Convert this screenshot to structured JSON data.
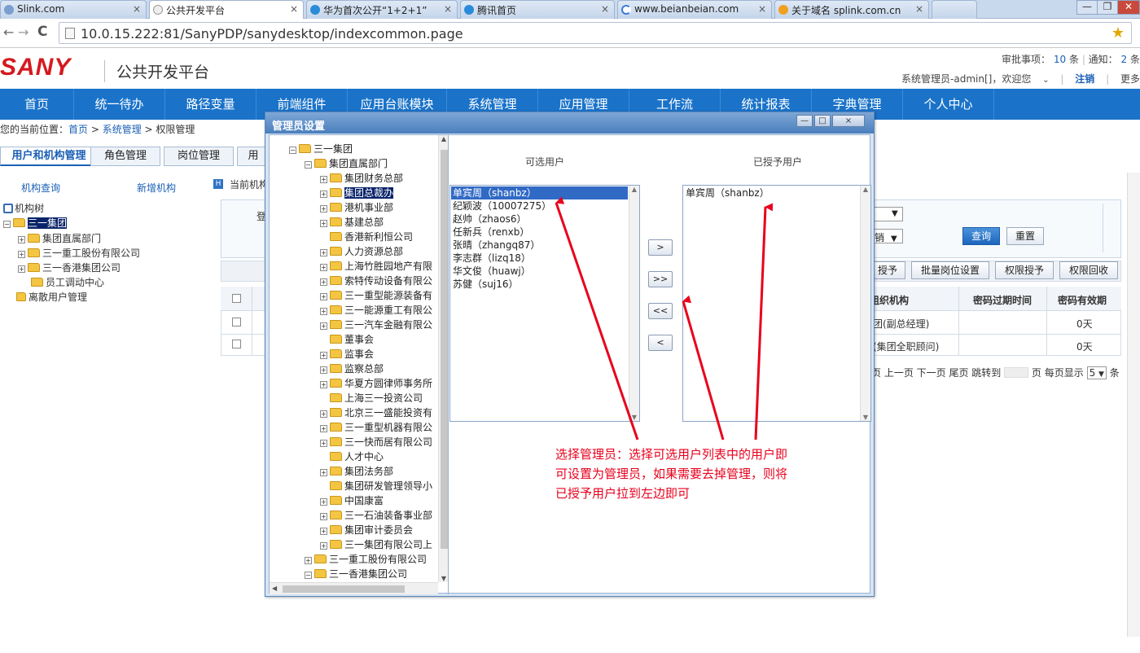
{
  "browser": {
    "tabs": [
      {
        "label": "Slink.com"
      },
      {
        "label": "公共开发平台"
      },
      {
        "label": "华为首次公开“1+2+1”"
      },
      {
        "label": "腾讯首页"
      },
      {
        "label": "www.beianbeian.com"
      },
      {
        "label": "关于域名 splink.com.cn"
      }
    ],
    "tab_close": "×",
    "url": "10.0.15.222:81/SanyPDP/sanydesktop/indexcommon.page",
    "back_glyph": "←",
    "forward_glyph": "→",
    "reload_glyph": "C",
    "star_glyph": "★",
    "menu_glyph": "≡",
    "win_min": "—",
    "win_max": "❐",
    "win_close": "✕"
  },
  "header": {
    "logo": "SANY",
    "platform": "公共开发平台",
    "approval_label": "审批事项：",
    "approval_count": "10",
    "approval_unit": "条",
    "notice_label": "通知：",
    "notice_count": "2",
    "notice_unit": "条",
    "welcome": "系统管理员-admin[]，欢迎您",
    "logout": "注销",
    "more": "更多"
  },
  "nav": [
    "首页",
    "统一待办",
    "路径变量",
    "前端组件",
    "应用台账模块",
    "系统管理",
    "应用管理",
    "工作流",
    "统计报表",
    "字典管理",
    "个人中心"
  ],
  "breadcrumb": {
    "prefix": "您的当前位置：",
    "home": "首页",
    "sep1": " > ",
    "system": "系统管理",
    "sep2": " > ",
    "current": "权限管理"
  },
  "page_tabs": [
    "用户和机构管理",
    "角色管理",
    "岗位管理",
    "用"
  ],
  "left_panel": {
    "query_org": "机构查询",
    "add_org": "新增机构",
    "tree_root": "机构树",
    "tree": [
      "三一集团",
      "集团直属部门",
      "三一重工股份有限公司",
      "三一香港集团公司",
      "员工调动中心",
      "离散用户管理"
    ]
  },
  "right_panel": {
    "current_org": "当前机构",
    "login_fragment": "登",
    "query_btn": "查询",
    "reset_btn": "重置",
    "select_glyph": "▼",
    "select2_fragment": "销",
    "actions": [
      "授予",
      "批量岗位设置",
      "权限授予",
      "权限回收"
    ],
    "table_headers": [
      "组织机构",
      "密码过期时间",
      "密码有效期"
    ],
    "rows": [
      {
        "org": "团(副总经理)",
        "expire": "",
        "validity": "0天"
      },
      {
        "org": "(集团全职顾问)",
        "expire": "",
        "validity": "0天"
      }
    ],
    "pager": "页 上一页 下一页 尾页 跳转到",
    "pager_mid": "页 每页显示",
    "page_size": "5",
    "pager_tail": "条"
  },
  "dialog": {
    "title": "管理员设置",
    "tree": [
      {
        "label": "三一集团",
        "level": 0,
        "exp": "−"
      },
      {
        "label": "集团直属部门",
        "level": 1,
        "exp": "−"
      },
      {
        "label": "集团财务总部",
        "level": 2,
        "exp": "+"
      },
      {
        "label": "集团总裁办",
        "level": 2,
        "exp": "+",
        "selected": true
      },
      {
        "label": "港机事业部",
        "level": 2,
        "exp": "+"
      },
      {
        "label": "基建总部",
        "level": 2,
        "exp": "+"
      },
      {
        "label": "香港新利恒公司",
        "level": 2,
        "exp": ""
      },
      {
        "label": "人力资源总部",
        "level": 2,
        "exp": "+"
      },
      {
        "label": "上海竹胜园地产有限",
        "level": 2,
        "exp": "+"
      },
      {
        "label": "索特传动设备有限公",
        "level": 2,
        "exp": "+"
      },
      {
        "label": "三一重型能源装备有",
        "level": 2,
        "exp": "+"
      },
      {
        "label": "三一能源重工有限公",
        "level": 2,
        "exp": "+"
      },
      {
        "label": "三一汽车金融有限公",
        "level": 2,
        "exp": "+"
      },
      {
        "label": "董事会",
        "level": 2,
        "exp": ""
      },
      {
        "label": "监事会",
        "level": 2,
        "exp": "+"
      },
      {
        "label": "监察总部",
        "level": 2,
        "exp": "+"
      },
      {
        "label": "华夏方圆律师事务所",
        "level": 2,
        "exp": "+"
      },
      {
        "label": "上海三一投资公司",
        "level": 2,
        "exp": ""
      },
      {
        "label": "北京三一盛能投资有",
        "level": 2,
        "exp": "+"
      },
      {
        "label": "三一重型机器有限公",
        "level": 2,
        "exp": "+"
      },
      {
        "label": "三一快而居有限公司",
        "level": 2,
        "exp": "+"
      },
      {
        "label": "人才中心",
        "level": 2,
        "exp": ""
      },
      {
        "label": "集团法务部",
        "level": 2,
        "exp": "+"
      },
      {
        "label": "集团研发管理领导小",
        "level": 2,
        "exp": ""
      },
      {
        "label": "中国康富",
        "level": 2,
        "exp": "+"
      },
      {
        "label": "三一石油装备事业部",
        "level": 2,
        "exp": "+"
      },
      {
        "label": "集团审计委员会",
        "level": 2,
        "exp": "+"
      },
      {
        "label": "三一集团有限公司上",
        "level": 2,
        "exp": "+"
      },
      {
        "label": "三一重工股份有限公司",
        "level": 1,
        "exp": "+"
      },
      {
        "label": "三一香港集团公司",
        "level": 1,
        "exp": "−"
      }
    ],
    "available_header": "可选用户",
    "granted_header": "已授予用户",
    "available_users": [
      "单宾周（shanbz）",
      "纪颖波（10007275）",
      "赵帅（zhaos6）",
      "任新兵（renxb）",
      "张晴（zhangq87）",
      "李志群（lizq18）",
      "华文俊（huawj）",
      "苏健（suj16）"
    ],
    "granted_users": [
      "单宾周（shanbz）"
    ],
    "buttons": {
      "add": ">",
      "add_all": ">>",
      "remove_all": "<<",
      "remove": "<"
    },
    "ctl_min": "—",
    "ctl_max": "□",
    "ctl_close": "×"
  },
  "annotation": "选择管理员：选择可选用户列表中的用户即可设置为管理员，如果需要去掉管理，则将已授予用户拉到左边即可",
  "colors": {
    "nav": "#1a73c9",
    "logo": "#d51920",
    "annotation": "#e8001c",
    "selected": "#316ac5"
  }
}
